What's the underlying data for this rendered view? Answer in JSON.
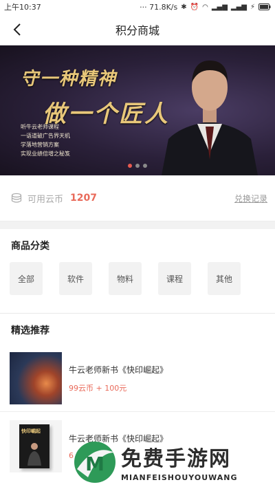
{
  "status_bar": {
    "carrier": "上午10:37",
    "net_speed": "···  71.8K/s",
    "battery": "⚡"
  },
  "nav": {
    "title": "积分商城"
  },
  "banner": {
    "headline_1": "守一种精神",
    "headline_2": "做一个匠人",
    "lines": [
      "听牛云老师课程",
      "一语道破广告界天机",
      "学落地营销方案",
      "实现业绩倍增之秘笈"
    ],
    "slide_count": 3,
    "active_slide": 1
  },
  "coins": {
    "label": "可用云币",
    "value": "1207",
    "exchange_link": "兑换记录"
  },
  "categories": {
    "title": "商品分类",
    "items": [
      "全部",
      "软件",
      "物料",
      "课程",
      "其他"
    ]
  },
  "featured": {
    "title": "精选推荐",
    "products": [
      {
        "name": "牛云老师新书《快印崛起》",
        "price": "99云币 + 100元",
        "cover_title": ""
      },
      {
        "name": "牛云老师新书《快印崛起》",
        "price": "6",
        "cover_title": "快印崛起"
      }
    ]
  },
  "watermark": {
    "cn": "免费手游网",
    "en": "MIANFEISHOUYOUWANG",
    "logo_letter": "M"
  },
  "colors": {
    "accent": "#e96a5a",
    "gold": "#e8c77a",
    "banner_bg": "#2a2039"
  }
}
